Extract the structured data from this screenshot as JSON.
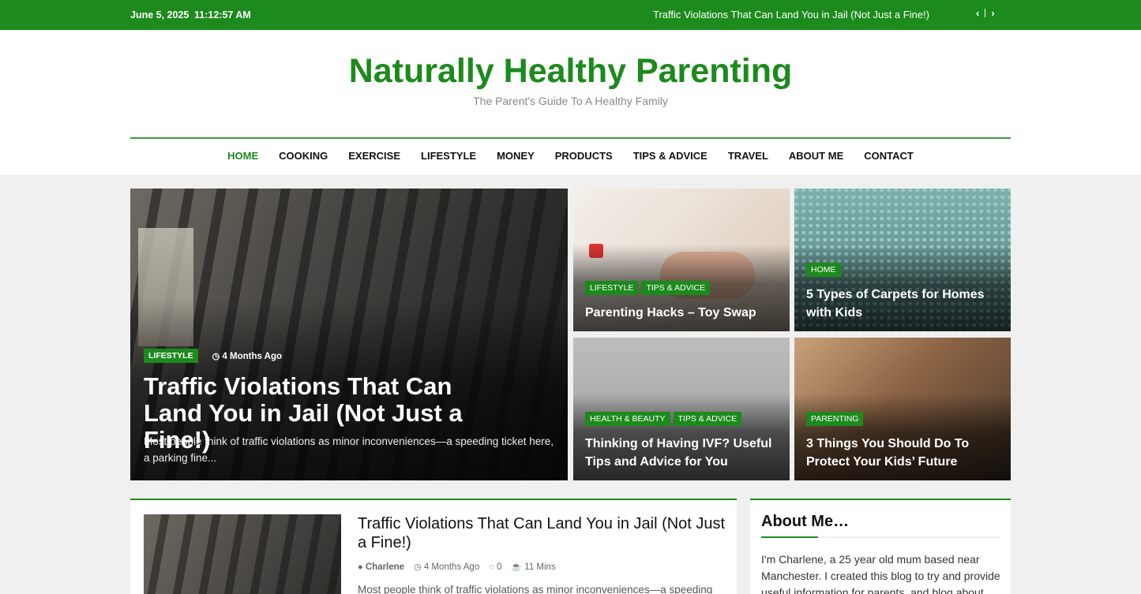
{
  "topbar": {
    "date": "June 5, 2025",
    "time": "11:12:57 AM",
    "ticker": "Traffic Violations That Can Land You in Jail (Not Just a Fine!)",
    "prev": "‹",
    "next": "›"
  },
  "site": {
    "title": "Naturally Healthy Parenting",
    "tagline": "The Parent's Guide To A Healthy Family"
  },
  "nav": [
    "HOME",
    "COOKING",
    "EXERCISE",
    "LIFESTYLE",
    "MONEY",
    "PRODUCTS",
    "TIPS & ADVICE",
    "TRAVEL",
    "ABOUT ME",
    "CONTACT"
  ],
  "hero": {
    "main": {
      "tag": "LIFESTYLE",
      "time": "4 Months Ago",
      "title": "Traffic Violations That Can Land You in Jail (Not Just a Fine!)",
      "excerpt": "Most people think of traffic violations as minor inconveniences—a speeding ticket here, a parking fine..."
    },
    "cards": [
      {
        "tags": [
          "LIFESTYLE",
          "TIPS & ADVICE"
        ],
        "title": "Parenting Hacks – Toy Swap"
      },
      {
        "tags": [
          "HOME"
        ],
        "title": "5 Types of Carpets for Homes with Kids"
      },
      {
        "tags": [
          "HEALTH & BEAUTY",
          "TIPS & ADVICE"
        ],
        "title": "Thinking of Having IVF? Useful Tips and Advice for You"
      },
      {
        "tags": [
          "PARENTING"
        ],
        "title": "3 Things You Should Do To Protect Your Kids’ Future"
      }
    ]
  },
  "post": {
    "title": "Traffic Violations That Can Land You in Jail (Not Just a Fine!)",
    "author": "Charlene",
    "time": "4 Months Ago",
    "comments": "0",
    "read": "11 Mins",
    "excerpt": "Most people think of traffic violations as minor inconveniences—a speeding"
  },
  "about": {
    "title": "About Me…",
    "text": "I'm Charlene, a 25 year old mum based near Manchester. I created this blog to try and provide useful information for parents, and blog about"
  },
  "colors": {
    "brand": "#1c8a1c"
  }
}
